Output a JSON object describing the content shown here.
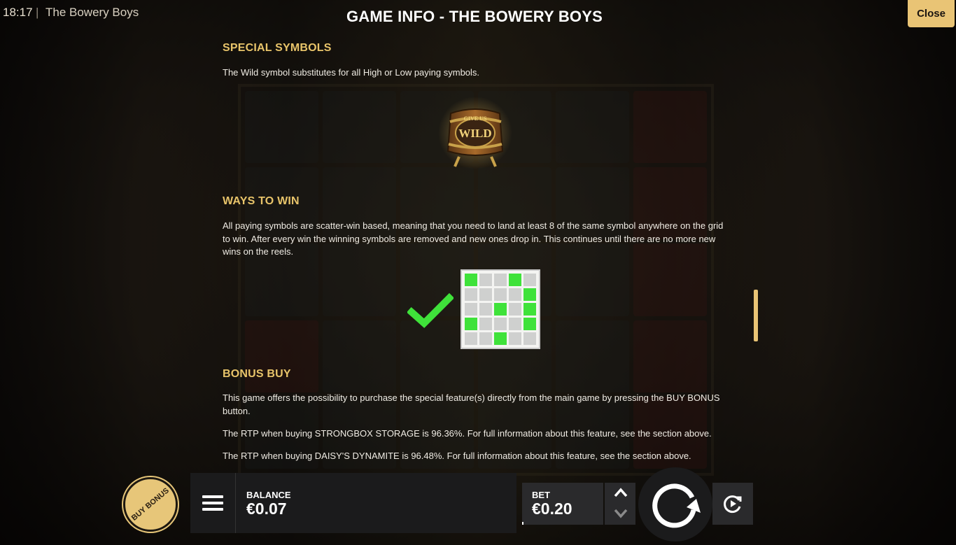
{
  "status_bar": {
    "time": "18:17",
    "separator": "|",
    "app_title": "The Bowery Boys"
  },
  "header": {
    "title": "GAME INFO - THE BOWERY BOYS",
    "close_label": "Close"
  },
  "sections": {
    "special_symbols": {
      "heading": "SPECIAL SYMBOLS",
      "text": "The Wild symbol substitutes for all High or Low paying symbols.",
      "symbol_lines": [
        "GIVE US",
        "WILD"
      ]
    },
    "ways_to_win": {
      "heading": "WAYS TO WIN",
      "text": "All paying symbols are scatter-win based, meaning that you need to land at least 8 of the same symbol anywhere on the grid to win. After every win the winning symbols are removed and new ones drop in. This continues until there are no more new wins on the reels.",
      "grid": [
        [
          1,
          0,
          0,
          1,
          0
        ],
        [
          0,
          0,
          0,
          0,
          1
        ],
        [
          0,
          0,
          1,
          0,
          1
        ],
        [
          1,
          0,
          0,
          0,
          1
        ],
        [
          0,
          0,
          1,
          0,
          0
        ]
      ]
    },
    "bonus_buy": {
      "heading": "BONUS BUY",
      "p1": "This game offers the possibility to purchase the special feature(s) directly from the main game by pressing the BUY BONUS button.",
      "p2": "The RTP when buying STRONGBOX STORAGE is 96.36%. For full information about this feature, see the section above.",
      "p3": "The RTP when buying DAISY'S DYNAMITE is 96.48%. For full information about this feature, see the section above."
    }
  },
  "bottom_bar": {
    "buy_bonus_label": "BUY BONUS",
    "balance_label": "BALANCE",
    "balance_value": "€0.07",
    "bet_label": "BET",
    "bet_value": "€0.20"
  },
  "colors": {
    "accent": "#e9c475",
    "heading": "#e8c46a",
    "win_green": "#3fe23a"
  },
  "icons": [
    "menu-icon",
    "chevron-up-icon",
    "chevron-down-icon",
    "spin-icon",
    "autoplay-icon",
    "checkmark-icon",
    "wild-barrel-icon"
  ]
}
